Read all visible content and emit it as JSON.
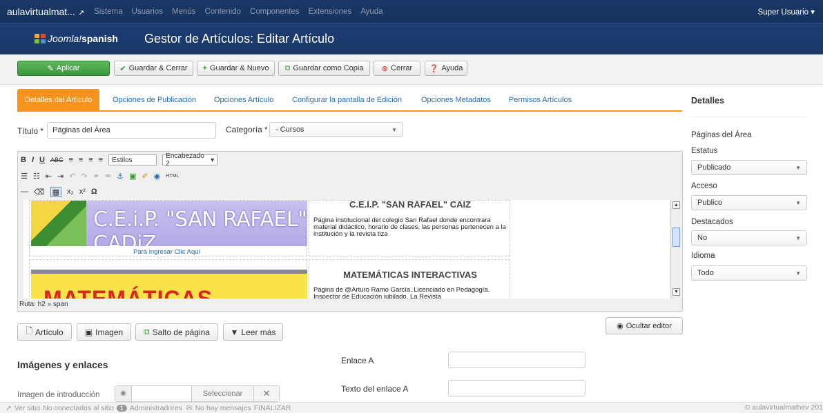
{
  "topbar": {
    "site": "aulavirtualmat...",
    "menu": [
      "Sistema",
      "Usuarios",
      "Menús",
      "Contenido",
      "Componentes",
      "Extensiones",
      "Ayuda"
    ],
    "user": "Super Usuario ▾"
  },
  "header": {
    "logo_joomla": "Joomla!",
    "logo_spanish": "spanish",
    "title": "Gestor de Artículos: Editar Artículo"
  },
  "toolbar": {
    "apply": "Aplicar",
    "save_close": "Guardar & Cerrar",
    "save_new": "Guardar & Nuevo",
    "save_copy": "Guardar como Copia",
    "close": "Cerrar",
    "help": "Ayuda"
  },
  "tabs": [
    "Detalles del Artículo",
    "Opciones de Publicación",
    "Opciones Artículo",
    "Configurar la pantalla de Edición",
    "Opciones Metadatos",
    "Permisos Artículos"
  ],
  "form": {
    "title_label": "Título *",
    "title_value": "Páginas del Área",
    "category_label": "Categoría *",
    "category_value": "- Cursos"
  },
  "editor": {
    "styles": "Estilos",
    "heading": "Encabezado 2",
    "cell1_banner": "C.E.i.P. \"SAN RAFAEL\" CADiZ",
    "cell1_link": "Para ingresar Clic Aquí",
    "cell2_heading": "C.E.I.P. \"SAN RAFAEL\" CAIZ",
    "cell2_text": "Página institucional del colegio San Rafael donde encontrara material didáctico, horario de clases, las personas pertenecen a la institución y la revista tiza",
    "cell3_banner": "MATEMÁTICAS INTERACTIVAS",
    "cell4_heading": "MATEMÁTICAS INTERACTIVAS",
    "cell4_text": "Página de @Arturo Ramo García. Licenciado en Pedagogía. Inspector de Educación jubilado. La Revista",
    "path": "Ruta: h2 » span"
  },
  "editor_buttons": {
    "article": "Artículo",
    "image": "Imagen",
    "pagebreak": "Salto de página",
    "readmore": "Leer más",
    "toggle": "Ocultar editor"
  },
  "images_links": {
    "section_title": "Imágenes y enlaces",
    "intro_image_label": "Imagen de introducción",
    "select": "Seleccionar",
    "link_a": "Enlace A",
    "link_a_text": "Texto del enlace A"
  },
  "sidebar": {
    "heading": "Detalles",
    "article_title": "Páginas del Área",
    "status_label": "Estatus",
    "status_value": "Publicado",
    "access_label": "Acceso",
    "access_value": "Publico",
    "featured_label": "Destacados",
    "featured_value": "No",
    "language_label": "Idioma",
    "language_value": "Todo"
  },
  "footer": {
    "view_site": "Ver sitio",
    "visitors": "No conectados al sitio",
    "admins_count": "1",
    "admins": "Administradores",
    "messages": "No hay mensajes",
    "finalize": "FINALIZAR",
    "copyright": "© aulavirtualmathev 201"
  },
  "colors": {
    "navbar": "#17325c",
    "accent_tab": "#f7941d",
    "apply_green": "#3a973a",
    "link_blue": "#1e6bb8"
  }
}
